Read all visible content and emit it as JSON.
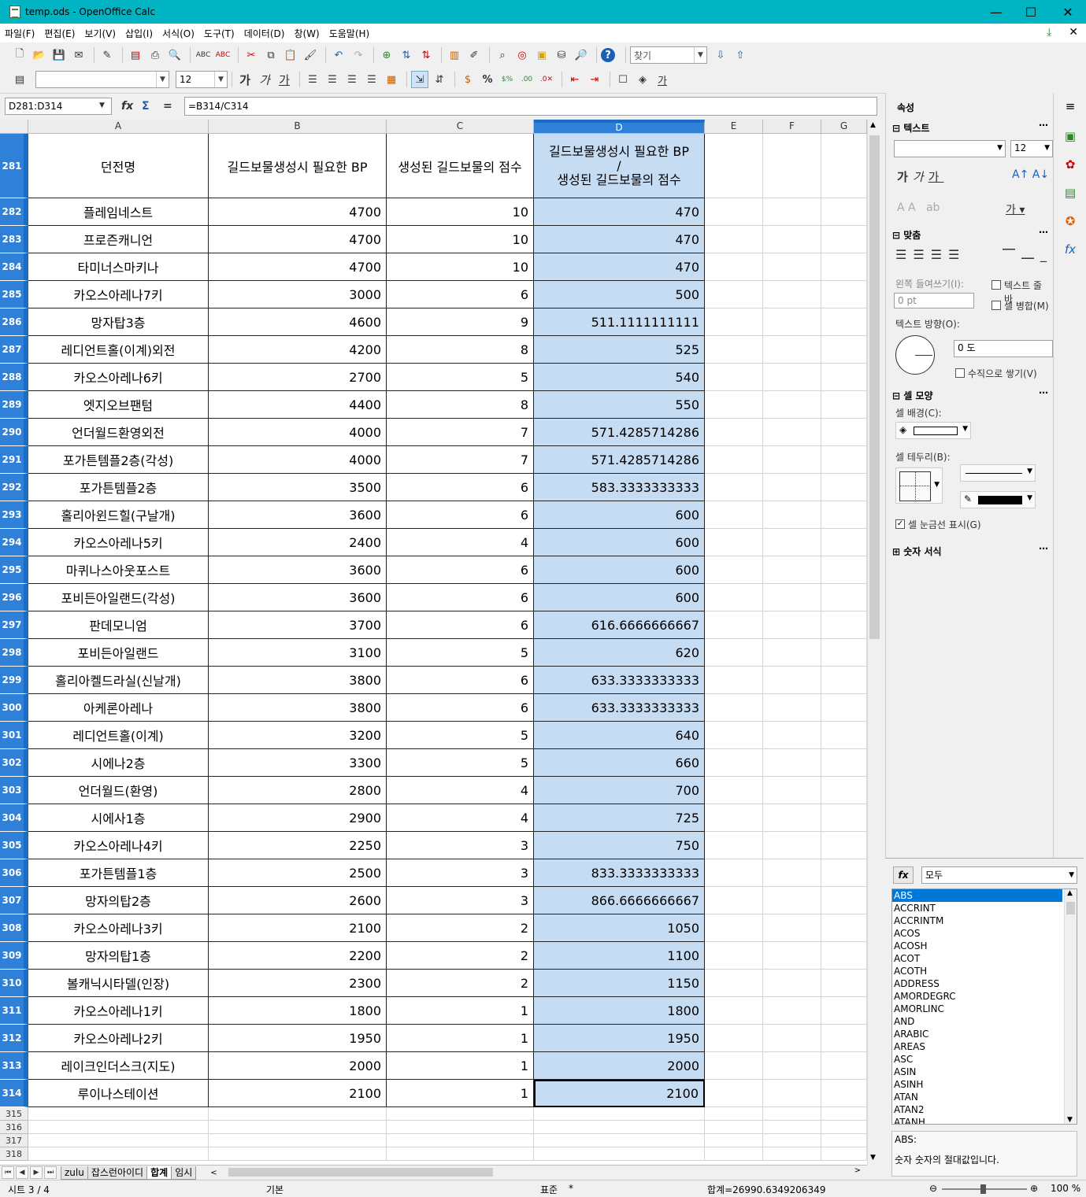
{
  "window": {
    "title": "temp.ods - OpenOffice Calc",
    "min": "—",
    "max": "☐",
    "close": "✕"
  },
  "menu": [
    "파일(F)",
    "편집(E)",
    "보기(V)",
    "삽입(I)",
    "서식(O)",
    "도구(T)",
    "데이터(D)",
    "창(W)",
    "도움말(H)"
  ],
  "toolbar": {
    "find_placeholder": "찾기",
    "font_size": "12",
    "font_name": ""
  },
  "formula_bar": {
    "name_box": "D281:D314",
    "formula": "=B314/C314"
  },
  "columns": [
    "A",
    "B",
    "C",
    "D",
    "E",
    "F",
    "G"
  ],
  "header_row": {
    "row": "281",
    "a": "던전명",
    "b": "길드보물생성시 필요한 BP",
    "c": "생성된 길드보물의 점수",
    "d_line1": "길드보물생성시 필요한 BP",
    "d_line2": "/",
    "d_line3": "생성된 길드보물의 점수"
  },
  "rows": [
    {
      "row": "282",
      "a": "플레임네스트",
      "b": "4700",
      "c": "10",
      "d": "470"
    },
    {
      "row": "283",
      "a": "프로즌캐니언",
      "b": "4700",
      "c": "10",
      "d": "470"
    },
    {
      "row": "284",
      "a": "타미너스마키나",
      "b": "4700",
      "c": "10",
      "d": "470"
    },
    {
      "row": "285",
      "a": "카오스아레나7키",
      "b": "3000",
      "c": "6",
      "d": "500"
    },
    {
      "row": "286",
      "a": "망자탑3층",
      "b": "4600",
      "c": "9",
      "d": "511.1111111111"
    },
    {
      "row": "287",
      "a": "레디언트홀(이계)외전",
      "b": "4200",
      "c": "8",
      "d": "525"
    },
    {
      "row": "288",
      "a": "카오스아레나6키",
      "b": "2700",
      "c": "5",
      "d": "540"
    },
    {
      "row": "289",
      "a": "엣지오브팬텀",
      "b": "4400",
      "c": "8",
      "d": "550"
    },
    {
      "row": "290",
      "a": "언더월드환영외전",
      "b": "4000",
      "c": "7",
      "d": "571.4285714286"
    },
    {
      "row": "291",
      "a": "포가튼템플2층(각성)",
      "b": "4000",
      "c": "7",
      "d": "571.4285714286"
    },
    {
      "row": "292",
      "a": "포가튼템플2층",
      "b": "3500",
      "c": "6",
      "d": "583.3333333333"
    },
    {
      "row": "293",
      "a": "홀리아윈드힐(구날개)",
      "b": "3600",
      "c": "6",
      "d": "600"
    },
    {
      "row": "294",
      "a": "카오스아레나5키",
      "b": "2400",
      "c": "4",
      "d": "600"
    },
    {
      "row": "295",
      "a": "마퀴나스아웃포스트",
      "b": "3600",
      "c": "6",
      "d": "600"
    },
    {
      "row": "296",
      "a": "포비든아일랜드(각성)",
      "b": "3600",
      "c": "6",
      "d": "600"
    },
    {
      "row": "297",
      "a": "판데모니엄",
      "b": "3700",
      "c": "6",
      "d": "616.6666666667"
    },
    {
      "row": "298",
      "a": "포비든아일랜드",
      "b": "3100",
      "c": "5",
      "d": "620"
    },
    {
      "row": "299",
      "a": "홀리아켈드라실(신날개)",
      "b": "3800",
      "c": "6",
      "d": "633.3333333333"
    },
    {
      "row": "300",
      "a": "아케론아레나",
      "b": "3800",
      "c": "6",
      "d": "633.3333333333"
    },
    {
      "row": "301",
      "a": "레디언트홀(이계)",
      "b": "3200",
      "c": "5",
      "d": "640"
    },
    {
      "row": "302",
      "a": "시에나2층",
      "b": "3300",
      "c": "5",
      "d": "660"
    },
    {
      "row": "303",
      "a": "언더월드(환영)",
      "b": "2800",
      "c": "4",
      "d": "700"
    },
    {
      "row": "304",
      "a": "시에사1층",
      "b": "2900",
      "c": "4",
      "d": "725"
    },
    {
      "row": "305",
      "a": "카오스아레나4키",
      "b": "2250",
      "c": "3",
      "d": "750"
    },
    {
      "row": "306",
      "a": "포가튼템플1층",
      "b": "2500",
      "c": "3",
      "d": "833.3333333333"
    },
    {
      "row": "307",
      "a": "망자의탑2층",
      "b": "2600",
      "c": "3",
      "d": "866.6666666667"
    },
    {
      "row": "308",
      "a": "카오스아레나3키",
      "b": "2100",
      "c": "2",
      "d": "1050"
    },
    {
      "row": "309",
      "a": "망자의탑1층",
      "b": "2200",
      "c": "2",
      "d": "1100"
    },
    {
      "row": "310",
      "a": "볼캐닉시타델(인장)",
      "b": "2300",
      "c": "2",
      "d": "1150"
    },
    {
      "row": "311",
      "a": "카오스아레나1키",
      "b": "1800",
      "c": "1",
      "d": "1800"
    },
    {
      "row": "312",
      "a": "카오스아레나2키",
      "b": "1950",
      "c": "1",
      "d": "1950"
    },
    {
      "row": "313",
      "a": "레이크인더스크(지도)",
      "b": "2000",
      "c": "1",
      "d": "2000"
    },
    {
      "row": "314",
      "a": "루이나스테이션",
      "b": "2100",
      "c": "1",
      "d": "2100"
    }
  ],
  "empty_rows": [
    "315",
    "316",
    "317",
    "318"
  ],
  "sheet_tabs": [
    {
      "label": "zulu",
      "active": false
    },
    {
      "label": "잡스런아이디",
      "active": false
    },
    {
      "label": "합계",
      "active": true
    },
    {
      "label": "임시",
      "active": false
    }
  ],
  "statusbar": {
    "sheet": "시트 3 / 4",
    "style": "기본",
    "mode": "표준",
    "modified": "*",
    "sum": "합계=26990.6349206349",
    "zoom": "100 %"
  },
  "sidebar": {
    "title": "속성",
    "sections": {
      "text": "텍스트",
      "align": "맞춤",
      "cell_look": "셀 모양",
      "number_format": "숫자 서식"
    },
    "font_size": "12",
    "indent_label": "왼쪽 들여쓰기(I):",
    "indent_value": "0 pt",
    "wrap_label": "텍스트 줄 바",
    "merge_label": "셀 병합(M)",
    "text_dir_label": "텍스트 방향(O):",
    "angle_value": "0 도",
    "vertical_stack_label": "수직으로 쌓기(V)",
    "cell_bg_label": "셀 배경(C):",
    "cell_border_label": "셀 테두리(B):",
    "show_grid_label": "셀 눈금선 표시(G)",
    "show_grid_checked": true
  },
  "function_panel": {
    "category": "모두",
    "items": [
      "ABS",
      "ACCRINT",
      "ACCRINTM",
      "ACOS",
      "ACOSH",
      "ACOT",
      "ACOTH",
      "ADDRESS",
      "AMORDEGRC",
      "AMORLINC",
      "AND",
      "ARABIC",
      "AREAS",
      "ASC",
      "ASIN",
      "ASINH",
      "ATAN",
      "ATAN2",
      "ATANH"
    ],
    "selected": "ABS",
    "desc_title": "ABS:",
    "desc_text": "숫자  숫자의 절대값입니다."
  }
}
